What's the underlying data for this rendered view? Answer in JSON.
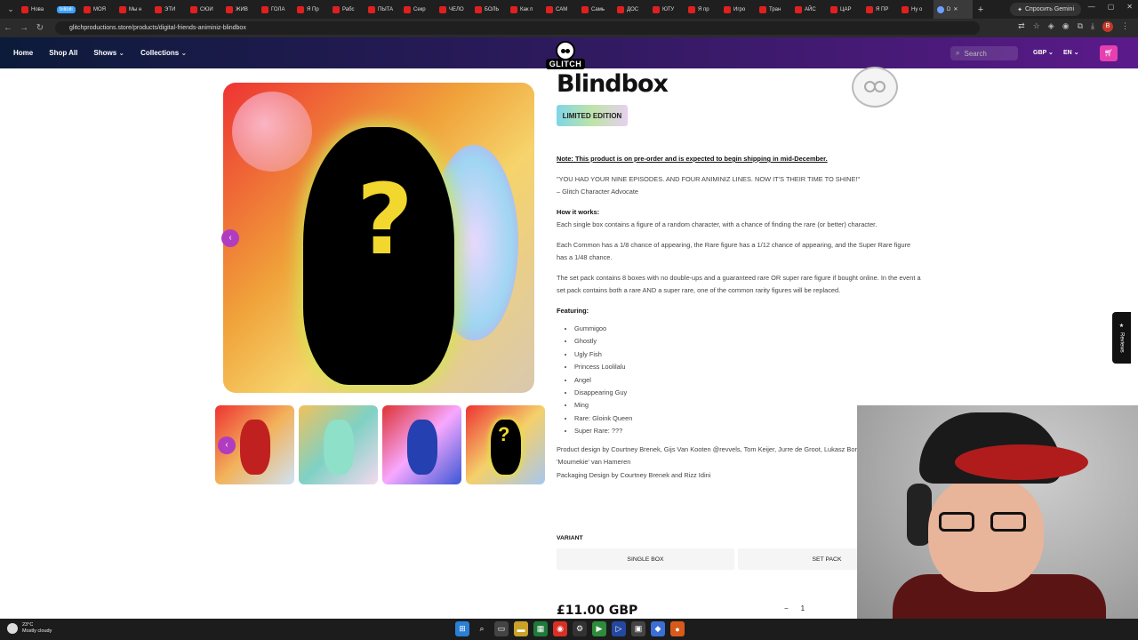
{
  "browser": {
    "tabs": [
      "Нова",
      "MOЯ",
      "Мы н",
      "ЭТИ",
      "СЮИ",
      "ЖИВ",
      "ГОЛА",
      "Я Пр",
      "Рабс",
      "ПЫТА",
      "Секр",
      "ЧЕЛО",
      "БОЛЬ",
      "Как п",
      "САМ",
      "Самь",
      "ДОС",
      "ЮТУ",
      "Я пр",
      "Игро",
      "Тран",
      "АЙС",
      "ЦАР",
      "Я ПР",
      "Ну о"
    ],
    "highlight_tab": "bilibili",
    "active_tab": "D",
    "gemini_label": "Спросить Gemini",
    "url": "glitchproductions.store/products/digital-friends-animiniz-blindbox",
    "avatar_letter": "В"
  },
  "site": {
    "nav": [
      "Home",
      "Shop All",
      "Shows",
      "Collections"
    ],
    "logo_text": "GLITCH",
    "search_placeholder": "Search",
    "currency": "GBP",
    "language": "EN"
  },
  "product": {
    "title": "Blindbox",
    "badge": "LIMITED EDITION",
    "note": "Note: This product is on pre-order and is expected to begin shipping in mid-December.",
    "quote": "\"YOU HAD YOUR NINE EPISODES. AND FOUR ANIMINIZ LINES. NOW IT'S THEIR TIME TO SHINE!\"",
    "quote_author": "– Glitch Character Advocate",
    "how_heading": "How it works:",
    "how_text": "Each single box contains a figure of a random character, with a chance of finding the rare (or better) character.",
    "odds_text": "Each Common has a 1/8 chance of appearing, the Rare figure has a 1/12 chance of appearing, and the Super Rare figure has a 1/48 chance.",
    "set_text": "The set pack contains 8 boxes with no double-ups and a guaranteed rare OR super rare figure if bought online. In the event a set pack contains both a rare AND a super rare, one of the common rarity figures will be replaced.",
    "featuring_heading": "Featuring:",
    "featuring": [
      "Gummigoo",
      "Ghostly",
      "Ugly Fish",
      "Princess Loolilalu",
      "Angel",
      "Disappearing Guy",
      "Ming",
      "Rare: Gloink Queen",
      "Super Rare: ???"
    ],
    "credits_design": "Product design by Courtney Brenek, Gijs Van Kooten @revvels, Tom Keijer, Jurre de Groot, Lukasz Borges and Gwyn 'Moumekie' van Hameren",
    "credits_packaging": "Packaging Design by Courtney Brenek and Rizz Idini",
    "variant_label": "VARIANT",
    "variants": [
      "SINGLE BOX",
      "SET PACK"
    ],
    "price": "£11.00 GBP",
    "quantity": "1",
    "qty_minus": "−",
    "reviews_label": "Reviews",
    "image_question": "?"
  },
  "taskbar": {
    "temp": "23°C",
    "weather": "Mostly cloudy"
  },
  "colors": {
    "accent": "#b03cc0",
    "cart": "#e63fb0"
  }
}
